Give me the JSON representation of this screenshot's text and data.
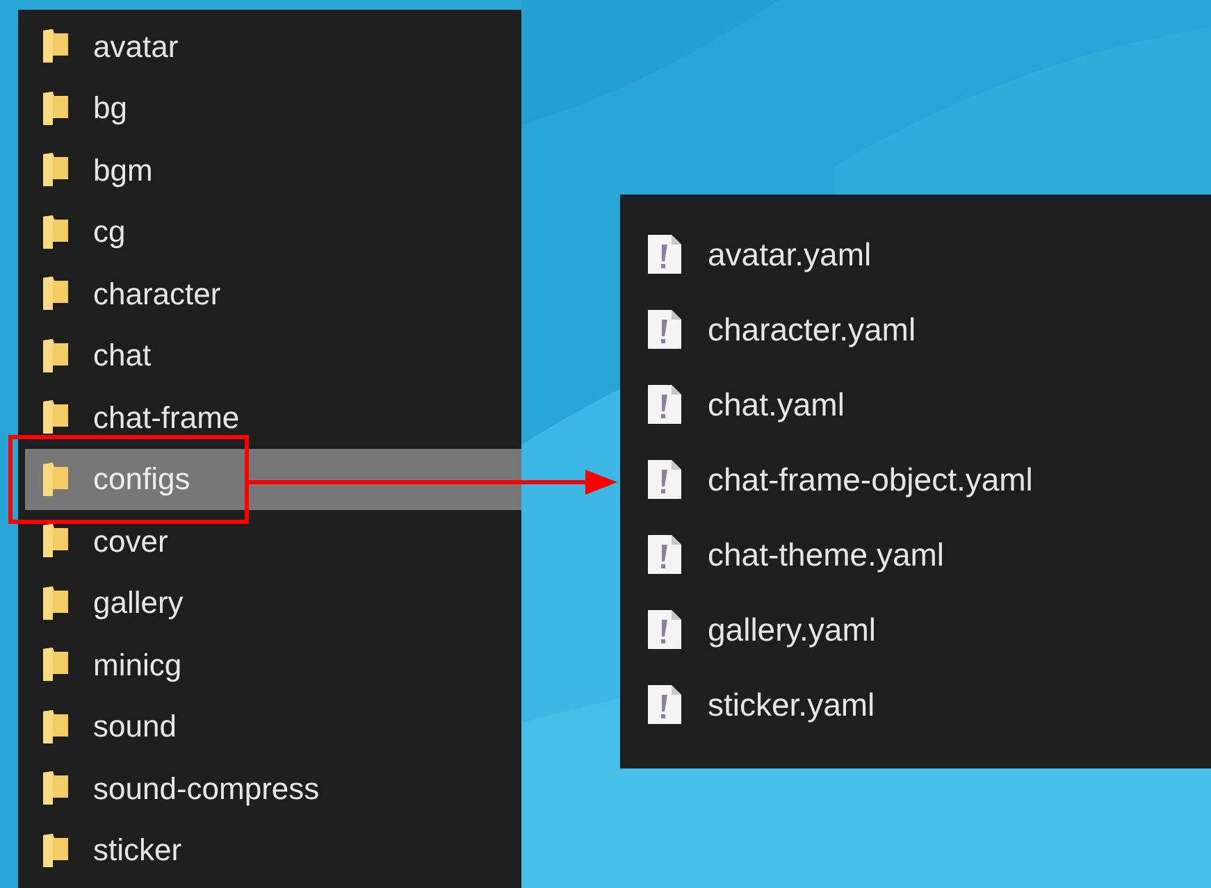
{
  "folders": [
    {
      "name": "avatar",
      "selected": false
    },
    {
      "name": "bg",
      "selected": false
    },
    {
      "name": "bgm",
      "selected": false
    },
    {
      "name": "cg",
      "selected": false
    },
    {
      "name": "character",
      "selected": false
    },
    {
      "name": "chat",
      "selected": false
    },
    {
      "name": "chat-frame",
      "selected": false
    },
    {
      "name": "configs",
      "selected": true
    },
    {
      "name": "cover",
      "selected": false
    },
    {
      "name": "gallery",
      "selected": false
    },
    {
      "name": "minicg",
      "selected": false
    },
    {
      "name": "sound",
      "selected": false
    },
    {
      "name": "sound-compress",
      "selected": false
    },
    {
      "name": "sticker",
      "selected": false
    }
  ],
  "files": [
    {
      "name": "avatar.yaml"
    },
    {
      "name": "character.yaml"
    },
    {
      "name": "chat.yaml"
    },
    {
      "name": "chat-frame-object.yaml"
    },
    {
      "name": "chat-theme.yaml"
    },
    {
      "name": "gallery.yaml"
    },
    {
      "name": "sticker.yaml"
    }
  ]
}
